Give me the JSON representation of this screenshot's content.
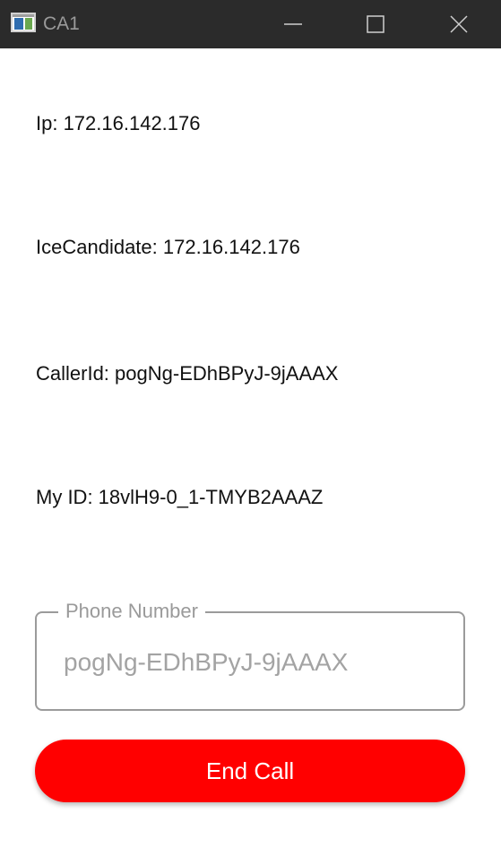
{
  "window": {
    "title": "CA1",
    "icons": {
      "app": "app-window-icon",
      "minimize": "minimize-icon",
      "maximize": "maximize-icon",
      "close": "close-icon"
    }
  },
  "info": {
    "ip": "Ip: 172.16.142.176",
    "ice_candidate": "IceCandidate: 172.16.142.176",
    "caller_id": "CallerId: pogNg-EDhBPyJ-9jAAAX",
    "my_id": "My ID: 18vlH9-0_1-TMYB2AAAZ"
  },
  "phone_field": {
    "label": "Phone Number",
    "value": "pogNg-EDhBPyJ-9jAAAX"
  },
  "actions": {
    "end_call_label": "End Call"
  },
  "colors": {
    "titlebar": "#2b2b2b",
    "end_call": "#ff0000",
    "field_border": "#9b9b9b"
  }
}
